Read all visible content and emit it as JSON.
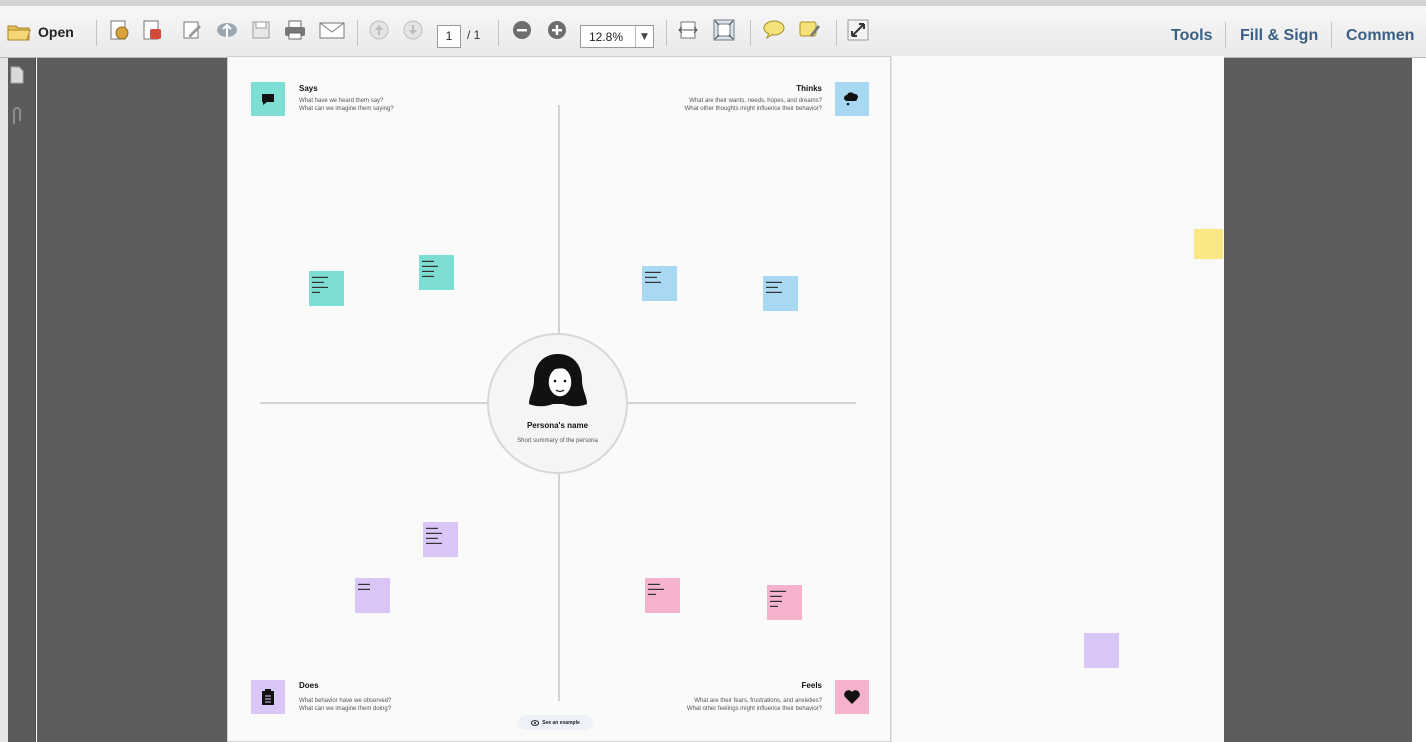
{
  "toolbar": {
    "open_label": "Open",
    "page_current": "1",
    "page_total": "/ 1",
    "zoom_value": "12.8%",
    "menu": {
      "tools": "Tools",
      "fill_sign": "Fill & Sign",
      "comment": "Commen"
    }
  },
  "canvas": {
    "says": {
      "title": "Says",
      "line1": "What have we heard them say?",
      "line2": "What can we imagine them saying?"
    },
    "thinks": {
      "title": "Thinks",
      "line1": "What are their wants, needs, hopes, and dreams?",
      "line2": "What other thoughts might influence their behavior?"
    },
    "does": {
      "title": "Does",
      "line1": "What behavior have we observed?",
      "line2": "What can we imagine them doing?"
    },
    "feels": {
      "title": "Feels",
      "line1": "What are their fears, frustrations, and anxieties?",
      "line2": "What other feelings might influence their behavior?"
    },
    "persona": {
      "name": "Persona's name",
      "summary": "Short summary of the persona"
    },
    "example_button": "See an example"
  },
  "colors": {
    "teal": "#7fded4",
    "blue": "#a9d8f2",
    "lavender": "#d9c6f7",
    "pink": "#f4b2cc",
    "yellow": "#fbe784",
    "menu_link": "#3a5f86",
    "workspace": "#5d5d5d"
  }
}
